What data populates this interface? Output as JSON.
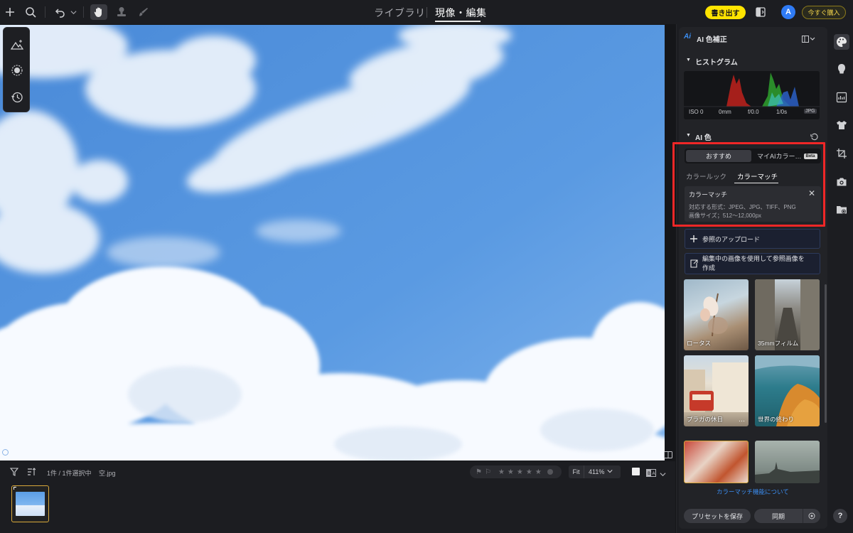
{
  "topbar": {
    "tab_library": "ライブラリ",
    "tab_develop": "現像・編集",
    "export_label": "書き出す",
    "avatar_initial": "A",
    "buy_label": "今すぐ購入"
  },
  "bottombar": {
    "selection_count": "1件 / 1件選択中",
    "filename": "空.jpg",
    "fit_label": "Fit",
    "zoom_value": "411%"
  },
  "panel": {
    "title": "AI 色補正",
    "histogram_title": "ヒストグラム",
    "exif": {
      "iso": "ISO 0",
      "focal": "0mm",
      "aperture": "f/0.0",
      "shutter": "1/0s",
      "format": "JPG"
    },
    "ai_color_title": "AI 色",
    "seg_recommended": "おすすめ",
    "seg_my_ai": "マイAIカラー…",
    "beta_label": "Beta",
    "subtab_color_look": "カラールック",
    "subtab_color_match": "カラーマッチ",
    "card": {
      "title": "カラーマッチ",
      "line1": "対応する形式：JPEG、JPG、TIFF、PNG",
      "line2": "画像サイズ；512〜12,000px"
    },
    "upload_label": "参照のアップロード",
    "create_ref_label_1": "編集中の画像を使用して参照画像を",
    "create_ref_label_2": "作成",
    "grid": [
      {
        "label": "ロータス"
      },
      {
        "label": "35mmフィルム"
      },
      {
        "label": "プラガの休日"
      },
      {
        "label": "世界の終わり"
      },
      {
        "label": ""
      },
      {
        "label": ""
      }
    ],
    "about_link": "カラーマッチ機能について",
    "save_preset_label": "プリセットを保存",
    "sync_label": "同期"
  },
  "colors": {
    "accent_yellow": "#ffe400",
    "highlight_red": "#ef2727",
    "link_blue": "#3b8ef2",
    "avatar_blue": "#2f7bf5"
  },
  "icons": [
    "plus-icon",
    "search-icon",
    "undo-icon",
    "hand-icon",
    "stamp-icon",
    "brush-icon",
    "compare-icon",
    "palette-icon",
    "face-icon",
    "texture-icon",
    "shirt-icon",
    "crop-icon",
    "camera-icon",
    "folder-icon",
    "help-icon"
  ]
}
